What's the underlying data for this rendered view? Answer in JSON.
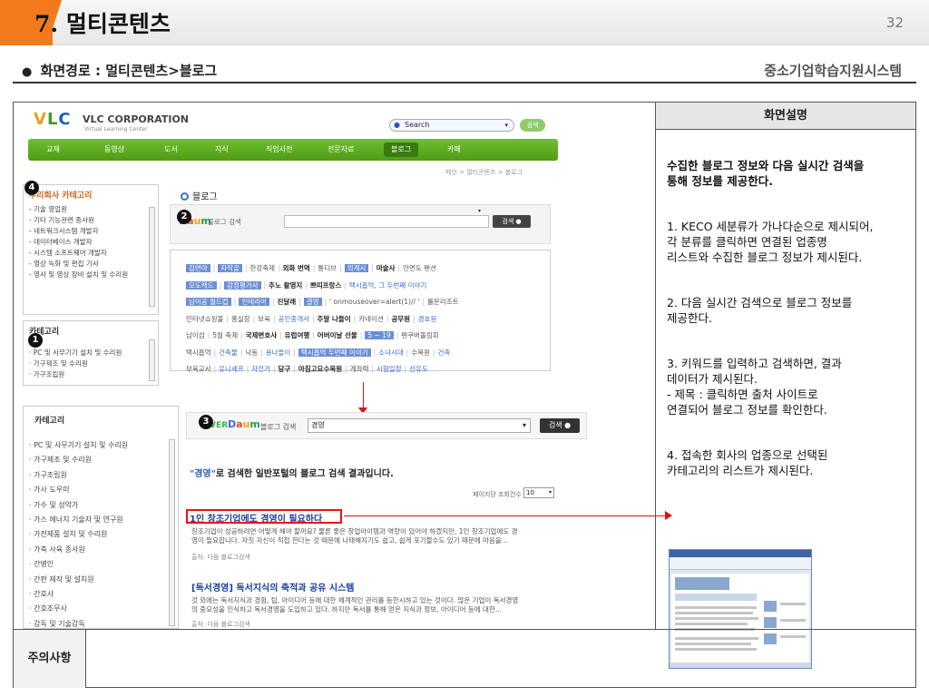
{
  "slide": {
    "number_label": "7.",
    "title": "멀티콘텐츠",
    "page_number": "32",
    "path_bullet": "●",
    "path": "화면경로 : 멀티콘텐츠>블로그",
    "system_name": "중소기업학습지원시스템"
  },
  "description": {
    "header": "화면설명",
    "lead": "수집한 블로그 정보와 다음 실시간 검색을\n통해 정보를 제공한다.",
    "items": [
      "1. KECO 세분류가 가나다순으로 제시되어,\n각 분류를 클릭하면 연결된 업종명\n리스트와 수집한 블로그 정보가 제시된다.",
      "2. 다음 실시간 검색으로 블로그 정보를\n제공한다.",
      "3. 키워드를 입력하고 검색하면, 결과\n데이터가 제시된다.\n- 제목 : 클릭하면 출처 사이트로\n연결되어 블로그 정보를 확인한다.",
      "4. 접속한 회사의 업종으로 선택된\n카테고리의 리스트가 제시된다."
    ]
  },
  "notice": {
    "label": "주의사항"
  },
  "site": {
    "logo_v": "V",
    "logo_l": "L",
    "logo_c": "C",
    "corp_name": "VLC CORPORATION",
    "corp_sub": "Virtual Learning Center",
    "search_placeholder": "Search",
    "search_button": "검색",
    "nav": [
      "교재",
      "동영상",
      "도서",
      "지식",
      "직업사전",
      "전문자료",
      "블로그",
      "카페"
    ],
    "breadcrumb": "메인 > 멀티콘텐츠 > 블로그",
    "company_category": {
      "title": "우리회사 카테고리",
      "items": [
        "- 기술 영업원",
        "- 기타 기능관련 종사원",
        "- 네트워크시스템 개발자",
        "- 데이터베이스 개발자",
        "- 시스템 소프트웨어 개발자",
        "- 영상 녹화 및 편집 기사",
        "- 영사 및 영상 장비 설치 및 수리원"
      ]
    },
    "category_small": {
      "title": "카테고리",
      "items": [
        "· PC 및 사무기기 설치 및 수리원",
        "· 가구제조 및 수리원",
        "· 가구조립원"
      ]
    },
    "category_large": {
      "title": "카테고리",
      "items": [
        "· PC 및 사무기기 설치 및 수리원",
        "· 가구제조 및 수리원",
        "· 가구조립원",
        "· 가사 도우미",
        "· 가수 및 성악가",
        "· 가스 에너지 기술자 및 연구원",
        "· 가전제품 설치 및 수리원",
        "· 가축 사육 종사원",
        "· 간병인",
        "· 간판 제작 및 설치원",
        "· 간호사",
        "· 간호조무사",
        "· 감독 및 기술감독"
      ]
    },
    "blog_title": "블로그",
    "daum": [
      "D",
      "a",
      "u",
      "m"
    ],
    "blog_search_label": "블로그 검색",
    "blog_search_button": "검색 ●",
    "keywords": [
      [
        {
          "t": "김연아",
          "s": "hl"
        },
        {
          "t": "자작골",
          "s": "hl"
        },
        {
          "t": "한강축제"
        },
        {
          "t": "외화 번역",
          "s": "b"
        },
        {
          "t": "통디브"
        },
        {
          "t": "의계시",
          "s": "hl"
        },
        {
          "t": "마술사",
          "s": "b"
        },
        {
          "t": "안면도 펜션"
        }
      ],
      [
        {
          "t": "모도캐드",
          "s": "hl"
        },
        {
          "t": "감정평가사",
          "s": "hl"
        },
        {
          "t": "추노 촬영지",
          "s": "b"
        },
        {
          "t": "쁘띠프랑스",
          "s": "b"
        },
        {
          "t": "택시흡억, 그 두번째 이야기",
          "s": "blue"
        }
      ],
      [
        {
          "t": "남이공 월드컵",
          "s": "hl"
        },
        {
          "t": "인테리어",
          "s": "hl"
        },
        {
          "t": "진달래",
          "s": "b"
        },
        {
          "t": "결영",
          "s": "hl"
        },
        {
          "t": "' onmouseover=alert(1)// '"
        },
        {
          "t": "룰문리조트"
        }
      ],
      [
        {
          "t": "인터넷쇼핑몰"
        },
        {
          "t": "홍실장"
        },
        {
          "t": "보육"
        },
        {
          "t": "공인중개사",
          "s": "blue"
        },
        {
          "t": "주말 나들이",
          "s": "b"
        },
        {
          "t": "카네이션"
        },
        {
          "t": "공무원",
          "s": "b"
        },
        {
          "t": "경호원",
          "s": "blue"
        }
      ],
      [
        {
          "t": "남이섬"
        },
        {
          "t": "5월 축제"
        },
        {
          "t": "국제변호사",
          "s": "b"
        },
        {
          "t": "유럽여행",
          "s": "b"
        },
        {
          "t": "어버이날 선물",
          "s": "b"
        },
        {
          "t": "5 ~ 19",
          "s": "hl"
        },
        {
          "t": "펜쿠버돌림휘"
        }
      ],
      [
        {
          "t": "택시흡억"
        },
        {
          "t": "건축물",
          "s": "blue"
        },
        {
          "t": "낙동"
        },
        {
          "t": "용나들이",
          "s": "blue"
        },
        {
          "t": "택시흡억 두번째 이야기",
          "s": "hl"
        },
        {
          "t": "소녀시대",
          "s": "blue"
        },
        {
          "t": "수목원"
        },
        {
          "t": "건축",
          "s": "blue"
        }
      ],
      [
        {
          "t": "보육교사"
        },
        {
          "t": "유니세프",
          "s": "blue"
        },
        {
          "t": "자전거",
          "s": "blue"
        },
        {
          "t": "당구",
          "s": "b"
        },
        {
          "t": "아침고요수목원",
          "s": "b"
        },
        {
          "t": "계좌력"
        },
        {
          "t": "시험일정",
          "s": "blue"
        },
        {
          "t": "선유도",
          "s": "blue"
        }
      ]
    ],
    "naver": "VER",
    "result_search_label": "블로그 검색",
    "result_search_value": "경영",
    "result_search_button": "검색 ●",
    "result_heading_kw": "\"경영\"",
    "result_heading_rest": "로 검색한 일반포털의 블로그 검색 결과입니다.",
    "per_page_label": "페이지당 조회건수",
    "per_page_value": "10",
    "results": [
      {
        "title": "1인 창조기업에도 경영이 필요하다",
        "snippet": "창조기업이 성공하려면 어떻게 해야 할까요? 물론 좋은 창업아이템과 역량이 있어야 하겠지만, 1인 창조기업에도 경\n영이 필요합니다. 자칫 자신이 직접 한다는 것 때문에 나태해지기도 쉽고, 쉽게 포기할수도 있기 때문에 마음을...",
        "source": "출처: 다음 블로그검색"
      },
      {
        "title": "[독서경영] 독서지식의 축적과 공유 시스템",
        "snippet": "것 외에는 독서지식과 경험, 팁, 아이디어 등에 대한 체계적인 관리를 등한시하고 있는 것이다. 많은 기업이 독서경영\n의 중요성을 인식하고 독서경영을 도입하고 있다. 하지만 독서를 통해 얻은 지식과 정보, 아이디어 등에 대한...",
        "source": "출처: 다음 블로그검색"
      }
    ],
    "badges": [
      "1",
      "2",
      "3",
      "4"
    ]
  },
  "colors": {
    "accent_orange": "#f27a1d",
    "nav_green": "#5fae22",
    "highlight_red": "#dd1111",
    "link_blue": "#1a3f9c"
  }
}
